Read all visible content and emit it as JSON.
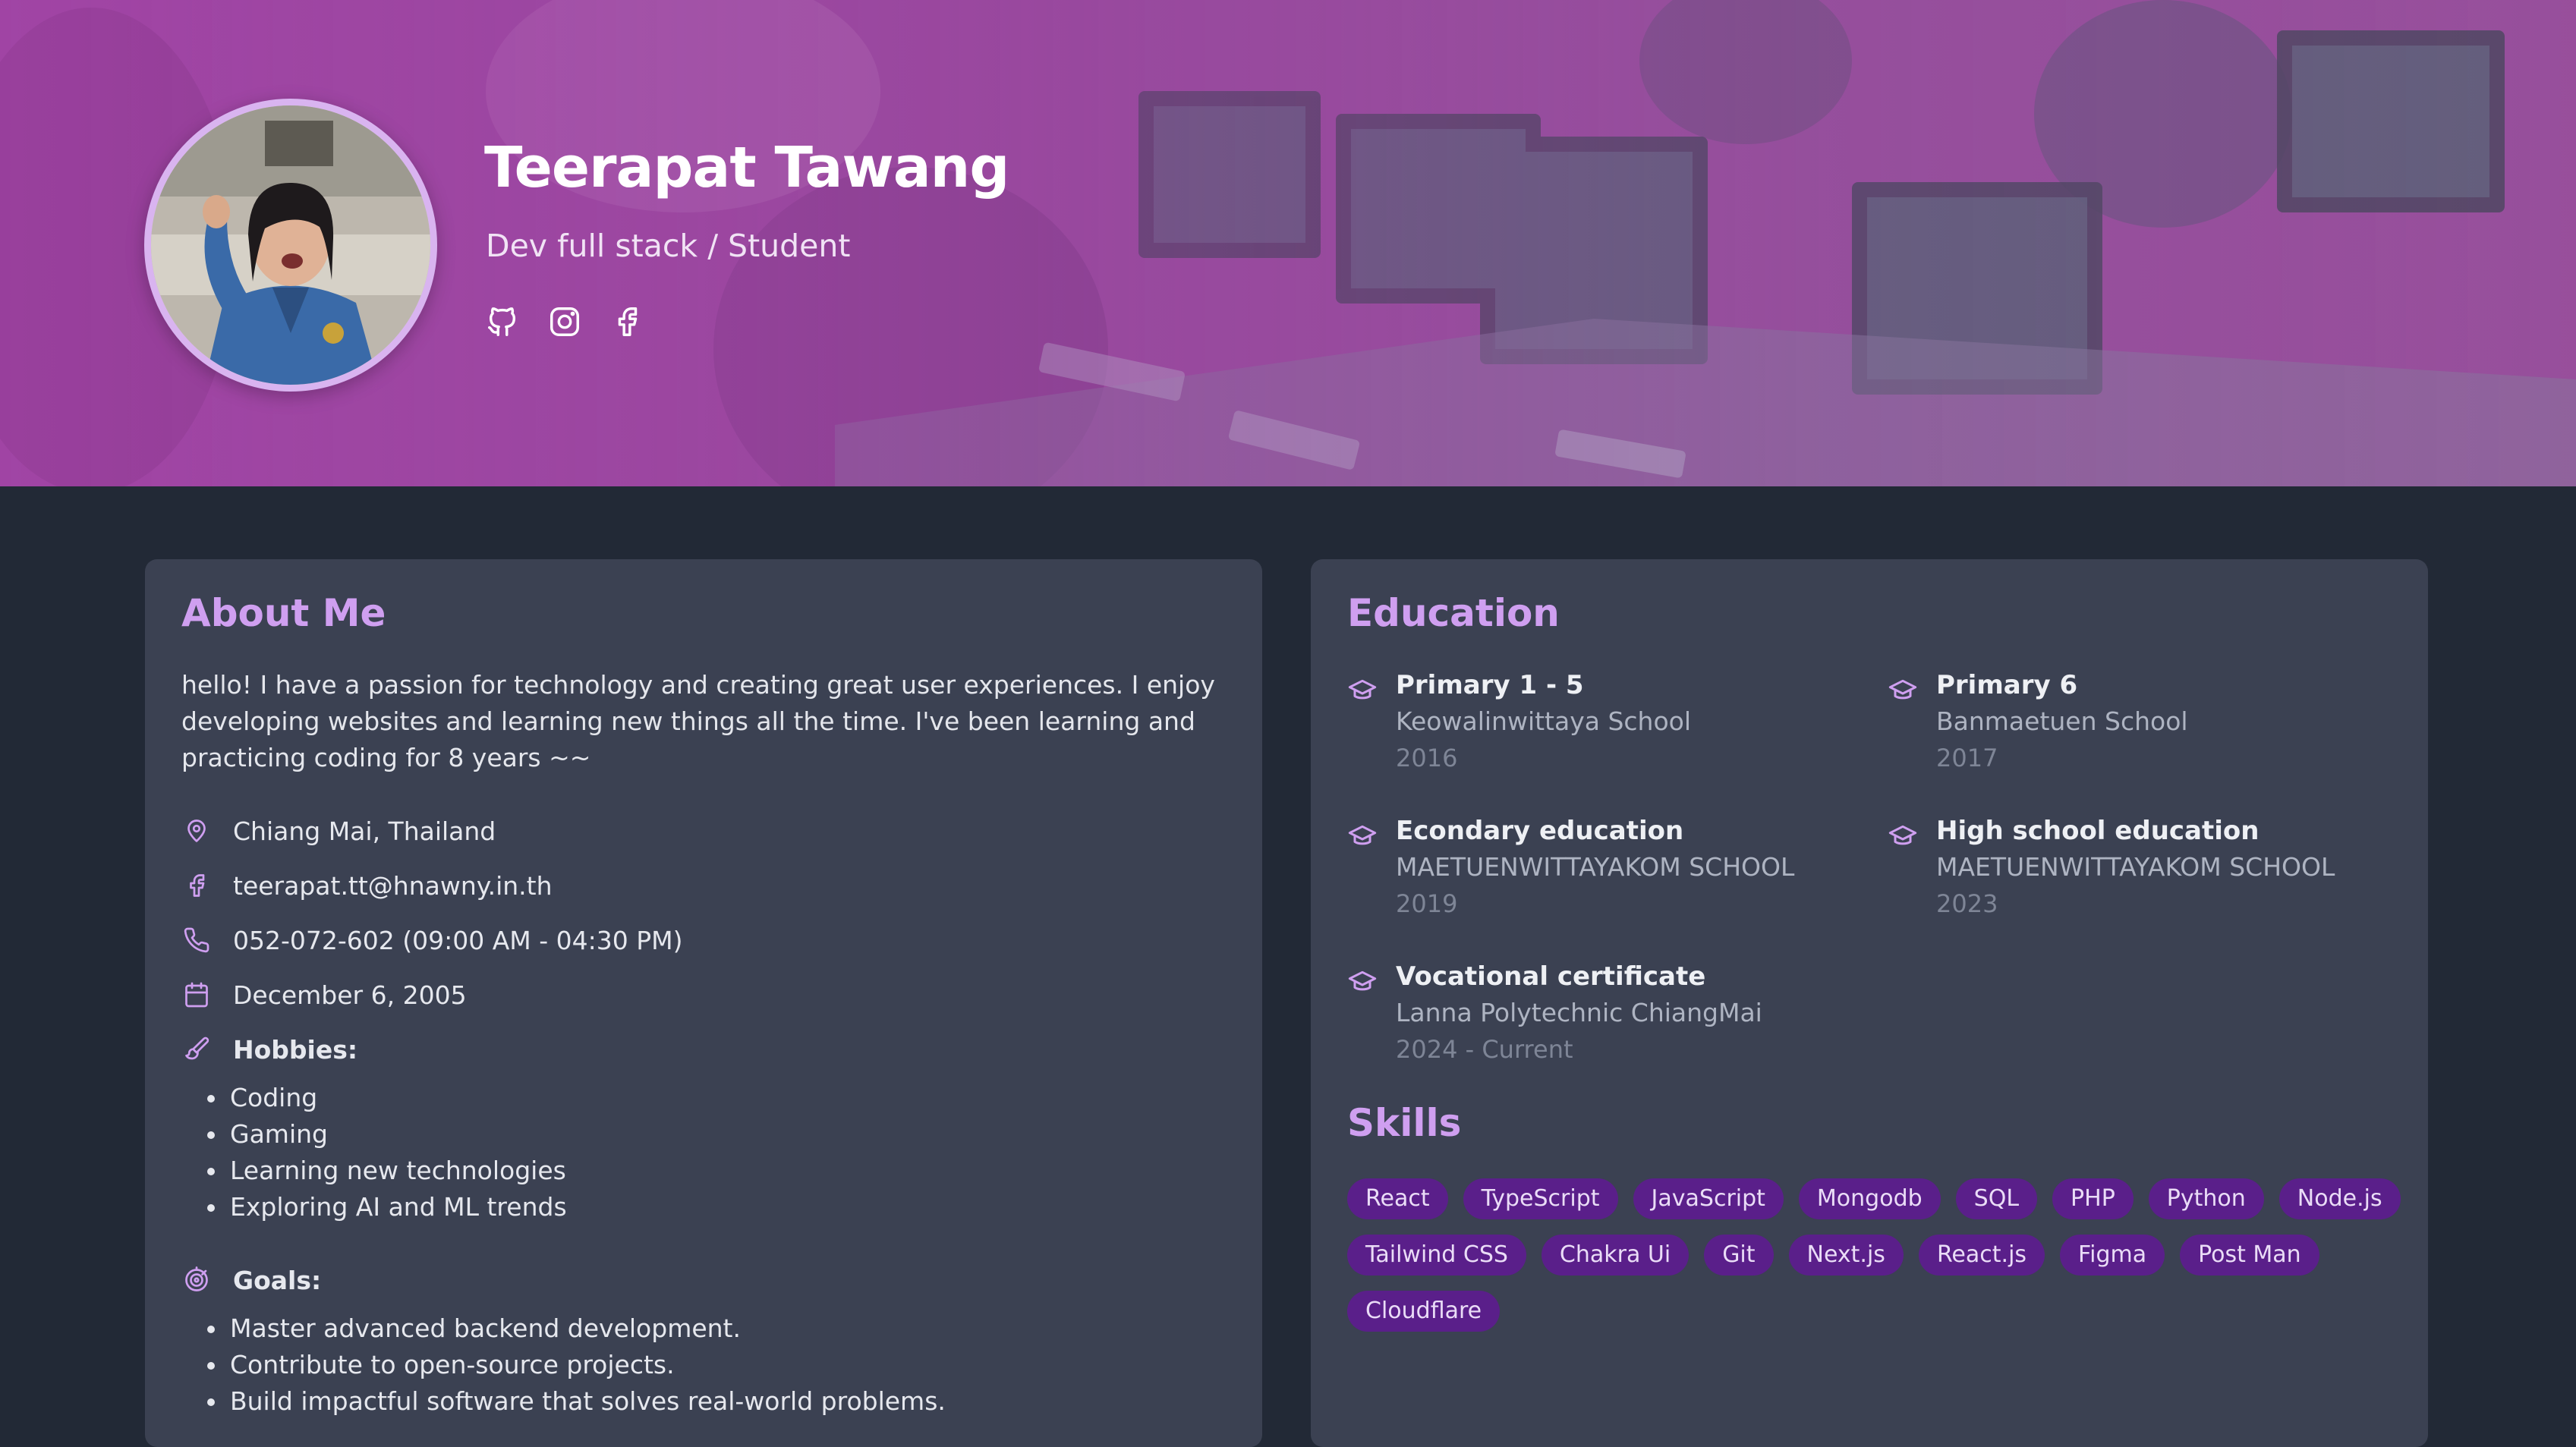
{
  "hero": {
    "name": "Teerapat Tawang",
    "role": "Dev full stack / Student",
    "socials": [
      {
        "name": "github",
        "icon": "github-icon"
      },
      {
        "name": "instagram",
        "icon": "instagram-icon"
      },
      {
        "name": "facebook",
        "icon": "facebook-icon"
      }
    ]
  },
  "about": {
    "title": "About Me",
    "text": "hello! I have a passion for technology and creating great user experiences. I enjoy developing websites and learning new things all the time. I've been learning and practicing coding for 8 years ~~",
    "location": "Chiang Mai, Thailand",
    "email": "teerapat.tt@hnawny.in.th",
    "phone": "052-072-602 (09:00 AM - 04:30 PM)",
    "birthday": "December 6, 2005",
    "hobbies_label": "Hobbies:",
    "hobbies": [
      "Coding",
      "Gaming",
      "Learning new technologies",
      "Exploring AI and ML trends"
    ],
    "goals_label": "Goals:",
    "goals": [
      "Master advanced backend development.",
      "Contribute to open-source projects.",
      "Build impactful software that solves real-world problems."
    ]
  },
  "education": {
    "title": "Education",
    "items": [
      {
        "level": "Primary 1 - 5",
        "school": "Keowalinwittaya School",
        "year": "2016"
      },
      {
        "level": "Primary 6",
        "school": "Banmaetuen School",
        "year": "2017"
      },
      {
        "level": "Econdary education",
        "school": "MAETUENWITTAYAKOM SCHOOL",
        "year": "2019"
      },
      {
        "level": "High school education",
        "school": "MAETUENWITTAYAKOM SCHOOL",
        "year": "2023"
      },
      {
        "level": "Vocational certificate",
        "school": "Lanna Polytechnic ChiangMai",
        "year": "2024 - Current"
      }
    ]
  },
  "skills": {
    "title": "Skills",
    "items": [
      "React",
      "TypeScript",
      "JavaScript",
      "Mongodb",
      "SQL",
      "PHP",
      "Python",
      "Node.js",
      "Tailwind CSS",
      "Chakra Ui",
      "Git",
      "Next.js",
      "React.js",
      "Figma",
      "Post Man",
      "Cloudflare"
    ]
  },
  "colors": {
    "accent": "#cf9ff0",
    "skill_bg": "#5a1f8a",
    "card_bg": "#3b4152",
    "page_bg": "#222936"
  }
}
